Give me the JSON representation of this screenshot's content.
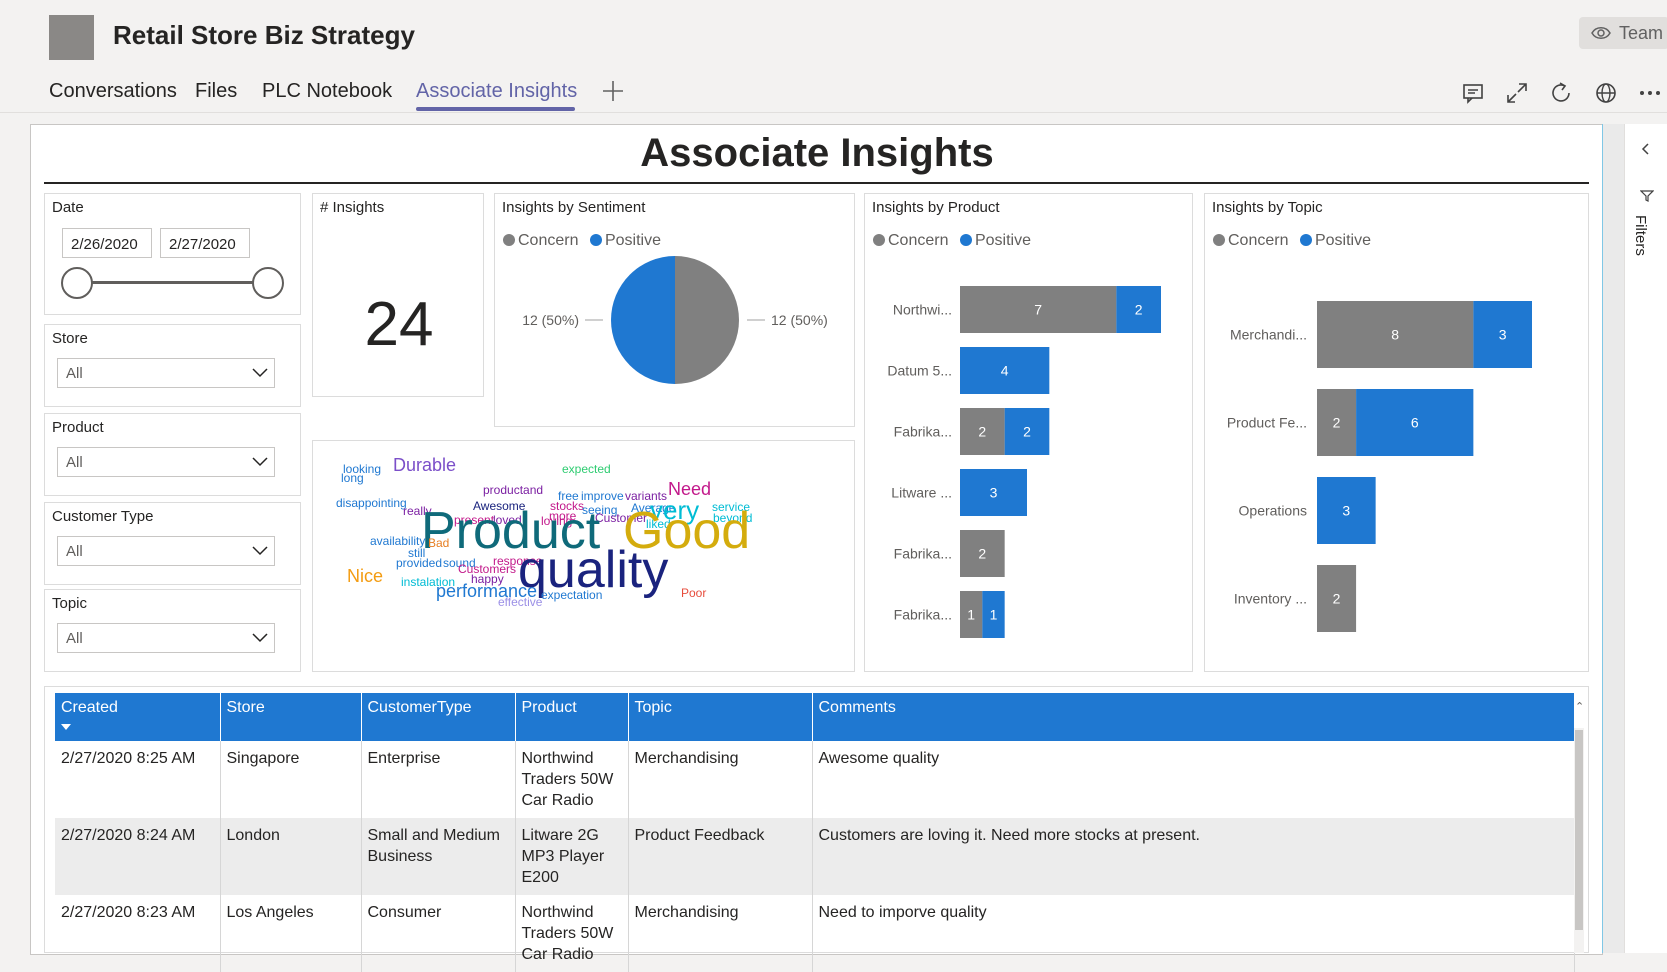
{
  "header": {
    "team_title": "Retail Store Biz Strategy",
    "team_button_label": "Team",
    "tabs": [
      {
        "label": "Conversations"
      },
      {
        "label": "Files"
      },
      {
        "label": "PLC Notebook"
      },
      {
        "label": "Associate Insights",
        "active": true
      }
    ],
    "add_tab_icon": "plus-icon",
    "actions": [
      "chat-icon",
      "expand-icon",
      "refresh-icon",
      "globe-icon",
      "more-icon"
    ]
  },
  "report": {
    "title": "Associate Insights",
    "filters_label": "Filters",
    "date_slicer": {
      "title": "Date",
      "start": "2/26/2020",
      "end": "2/27/2020"
    },
    "slicers": [
      {
        "title": "Store",
        "value": "All"
      },
      {
        "title": "Product",
        "value": "All"
      },
      {
        "title": "Customer Type",
        "value": "All"
      },
      {
        "title": "Topic",
        "value": "All"
      }
    ],
    "insights_count": {
      "title": "# Insights",
      "value": "24"
    },
    "legend": {
      "concern": "Concern",
      "positive": "Positive"
    },
    "colors": {
      "concern": "#808080",
      "positive": "#1f78d1",
      "header": "#1f78d1",
      "accent": "#6264a7"
    },
    "word_cloud": [
      {
        "text": "looking",
        "color": "#1f78d1"
      },
      {
        "text": "long",
        "color": "#1f78d1"
      },
      {
        "text": "Durable",
        "color": "#7b4fc9"
      },
      {
        "text": "expected",
        "color": "#2ecc71"
      },
      {
        "text": "productand",
        "color": "#7b1fa2"
      },
      {
        "text": "Need",
        "color": "#c2188a"
      },
      {
        "text": "disappointing",
        "color": "#1f78d1"
      },
      {
        "text": "free",
        "color": "#1f78d1"
      },
      {
        "text": "improve",
        "color": "#1f78d1"
      },
      {
        "text": "variants",
        "color": "#7b1fa2"
      },
      {
        "text": "Awesome",
        "color": "#1a237e"
      },
      {
        "text": "stocks",
        "color": "#c2188a"
      },
      {
        "text": "seeing",
        "color": "#1f78d1"
      },
      {
        "text": "Average",
        "color": "#1f78d1"
      },
      {
        "text": "service",
        "color": "#00bcd4"
      },
      {
        "text": "really",
        "color": "#7b1fa2"
      },
      {
        "text": "more",
        "color": "#c2188a"
      },
      {
        "text": "very",
        "color": "#00bcd4"
      },
      {
        "text": "beyond",
        "color": "#00bcd4"
      },
      {
        "text": "present",
        "color": "#c2188a"
      },
      {
        "text": "loved",
        "color": "#7b1fa2"
      },
      {
        "text": "loving",
        "color": "#c2188a"
      },
      {
        "text": "Customer",
        "color": "#7b1fa2"
      },
      {
        "text": "liked",
        "color": "#00bcd4"
      },
      {
        "text": "availability",
        "color": "#1f78d1"
      },
      {
        "text": "Product",
        "color": "#0f6a7a"
      },
      {
        "text": "Good",
        "color": "#d4ac0d"
      },
      {
        "text": "Bad",
        "color": "#e67e22"
      },
      {
        "text": "still",
        "color": "#1f78d1"
      },
      {
        "text": "provided",
        "color": "#1f78d1"
      },
      {
        "text": "sound",
        "color": "#1f78d1"
      },
      {
        "text": "response",
        "color": "#c2188a"
      },
      {
        "text": "quality",
        "color": "#1a237e"
      },
      {
        "text": "Customers",
        "color": "#c2188a"
      },
      {
        "text": "Nice",
        "color": "#f39c12"
      },
      {
        "text": "happy",
        "color": "#7b1fa2"
      },
      {
        "text": "instalation",
        "color": "#00bcd4"
      },
      {
        "text": "performance",
        "color": "#1f78d1"
      },
      {
        "text": "expectation",
        "color": "#1f78d1"
      },
      {
        "text": "effective",
        "color": "#9b8fe6"
      },
      {
        "text": "Poor",
        "color": "#e74c3c"
      }
    ],
    "table": {
      "columns": [
        "Created",
        "Store",
        "CustomerType",
        "Product",
        "Topic",
        "Comments"
      ],
      "sort_icon": "sort-down-icon",
      "rows": [
        {
          "created": "2/27/2020 8:25 AM",
          "store": "Singapore",
          "customer_type": "Enterprise",
          "product": "Northwind Traders 50W Car Radio",
          "topic": "Merchandising",
          "comments": "Awesome quality"
        },
        {
          "created": "2/27/2020 8:24 AM",
          "store": "London",
          "customer_type": "Small and Medium Business",
          "product": "Litware 2G MP3 Player E200",
          "topic": "Product Feedback",
          "comments": "Customers are loving it. Need more stocks at present."
        },
        {
          "created": "2/27/2020 8:23 AM",
          "store": "Los Angeles",
          "customer_type": "Consumer",
          "product": "Northwind Traders 50W Car Radio",
          "topic": "Merchandising",
          "comments": "Need to imporve quality"
        }
      ]
    }
  },
  "chart_data": [
    {
      "type": "pie",
      "title": "Insights by Sentiment",
      "categories": [
        "Concern",
        "Positive"
      ],
      "values": [
        12,
        12
      ],
      "labels": [
        "12 (50%)",
        "12 (50%)"
      ]
    },
    {
      "type": "bar",
      "orientation": "horizontal",
      "stacked": true,
      "title": "Insights by Product",
      "categories": [
        "Northwi...",
        "Datum 5...",
        "Fabrika...",
        "Litware ...",
        "Fabrika...",
        "Fabrika..."
      ],
      "series": [
        {
          "name": "Concern",
          "values": [
            7,
            0,
            2,
            0,
            2,
            1
          ]
        },
        {
          "name": "Positive",
          "values": [
            2,
            4,
            2,
            3,
            0,
            1
          ]
        }
      ],
      "xlim": [
        0,
        9
      ]
    },
    {
      "type": "bar",
      "orientation": "horizontal",
      "stacked": true,
      "title": "Insights by Topic",
      "categories": [
        "Merchandi...",
        "Product Fe...",
        "Operations",
        "Inventory ..."
      ],
      "series": [
        {
          "name": "Concern",
          "values": [
            8,
            2,
            0,
            2
          ]
        },
        {
          "name": "Positive",
          "values": [
            3,
            6,
            3,
            0
          ]
        }
      ],
      "xlim": [
        0,
        11
      ]
    }
  ]
}
